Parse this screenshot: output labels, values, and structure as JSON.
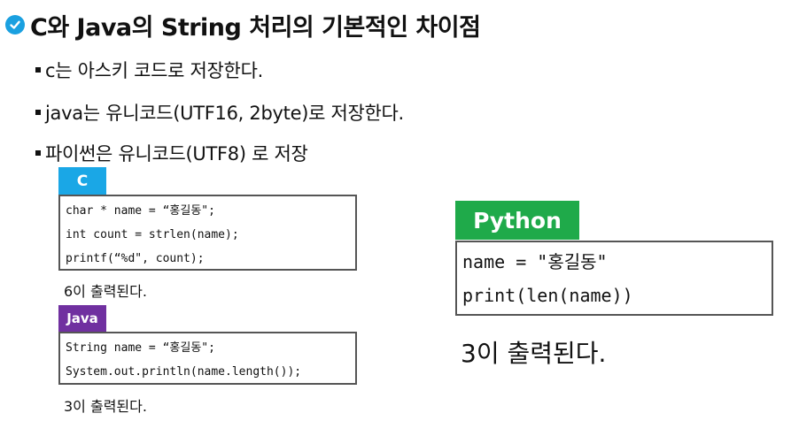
{
  "title": "C와 Java의 String 처리의 기본적인 차이점",
  "bullets": [
    "c는 아스키 코드로 저장한다.",
    "java는 유니코드(UTF16, 2byte)로 저장한다.",
    "파이썬은 유니코드(UTF8) 로 저장"
  ],
  "c_block": {
    "tag": "C",
    "tag_color": "#1aa7e6",
    "code": [
      "char * name = “홍길동\";",
      "int count = strlen(name);",
      "printf(“%d\", count);"
    ],
    "result": "6이 출력된다."
  },
  "java_block": {
    "tag": "Java",
    "tag_color": "#7030a0",
    "code": [
      "String name = “홍길동\";",
      "System.out.println(name.length());"
    ],
    "result": "3이 출력된다."
  },
  "python_block": {
    "tag": "Python",
    "tag_color": "#1faa4a",
    "code": [
      "name = \"홍길동\"",
      "print(len(name))"
    ],
    "result": "3이 출력된다."
  },
  "icons": {
    "title_icon": "check-circle-icon",
    "bullet_icon": "square-bullet-icon"
  }
}
